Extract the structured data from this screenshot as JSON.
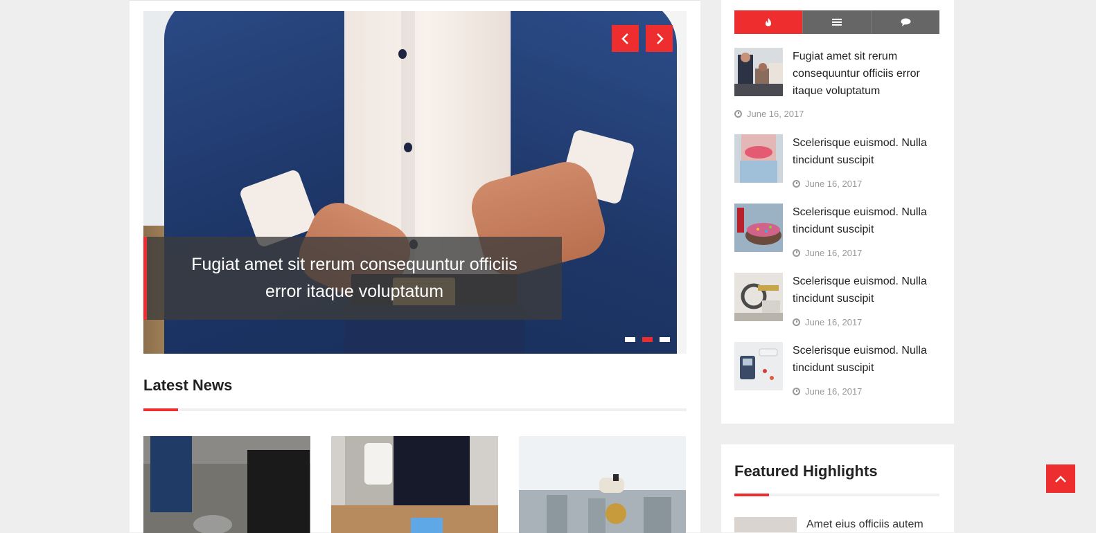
{
  "slider": {
    "caption": "Fugiat amet sit rerum consequuntur officiis error itaque voluptatum",
    "prev_icon": "chevron-left",
    "next_icon": "chevron-right",
    "slide_count": 3,
    "active_slide": 2
  },
  "latest_news": {
    "title": "Latest News"
  },
  "sidebar": {
    "tabs": [
      {
        "icon": "fire-icon",
        "glyph": "🔥",
        "active": true
      },
      {
        "icon": "list-icon",
        "glyph": "≣",
        "active": false
      },
      {
        "icon": "comment-icon",
        "glyph": "💬",
        "active": false
      }
    ],
    "posts": [
      {
        "title": "Fugiat amet sit rerum consequuntur officiis error itaque voluptatum",
        "date": "June 16, 2017"
      },
      {
        "title": "Scelerisque euismod. Nulla tincidunt suscipit",
        "date": "June 16, 2017"
      },
      {
        "title": "Scelerisque euismod. Nulla tincidunt suscipit",
        "date": "June 16, 2017"
      },
      {
        "title": "Scelerisque euismod. Nulla tincidunt suscipit",
        "date": "June 16, 2017"
      },
      {
        "title": "Scelerisque euismod. Nulla tincidunt suscipit",
        "date": "June 16, 2017"
      }
    ]
  },
  "featured": {
    "title": "Featured Highlights",
    "first_item": "Amet eius officiis autem"
  },
  "colors": {
    "accent": "#ee2e2e",
    "tab_inactive": "#666666"
  }
}
